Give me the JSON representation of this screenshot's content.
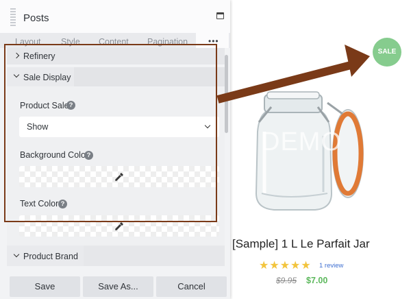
{
  "panel": {
    "title": "Posts",
    "tabs": [
      {
        "label": "Layout"
      },
      {
        "label": "Style"
      },
      {
        "label": "Content"
      },
      {
        "label": "Pagination"
      }
    ],
    "more_label": "•••",
    "sections": {
      "refinery": {
        "label": "Refinery"
      },
      "sale_display": {
        "label": "Sale Display",
        "product_sale": {
          "label": "Product Sale",
          "value": "Show"
        },
        "background_color": {
          "label": "Background Color"
        },
        "text_color": {
          "label": "Text Color"
        }
      },
      "product_brand": {
        "label": "Product Brand"
      }
    },
    "buttons": {
      "save": "Save",
      "save_as": "Save As...",
      "cancel": "Cancel"
    }
  },
  "preview": {
    "sale_badge": "SALE",
    "watermark": "DEMO",
    "product_title": "[Sample] 1 L Le Parfait Jar",
    "rating_stars": 5,
    "stars": "★★★★★",
    "review_link": "1 review",
    "price_old": "$9.95",
    "price_new": "$7.00"
  },
  "colors": {
    "highlight": "#7a3a18",
    "sale_badge": "#86cc8e",
    "stars": "#f2c43d",
    "review_link": "#3e6fd1",
    "price_new": "#5cb85c"
  },
  "icons": [
    "drag-handle-icon",
    "maximize-icon",
    "chevron-right-icon",
    "chevron-down-icon",
    "help-icon",
    "eyedropper-icon"
  ]
}
